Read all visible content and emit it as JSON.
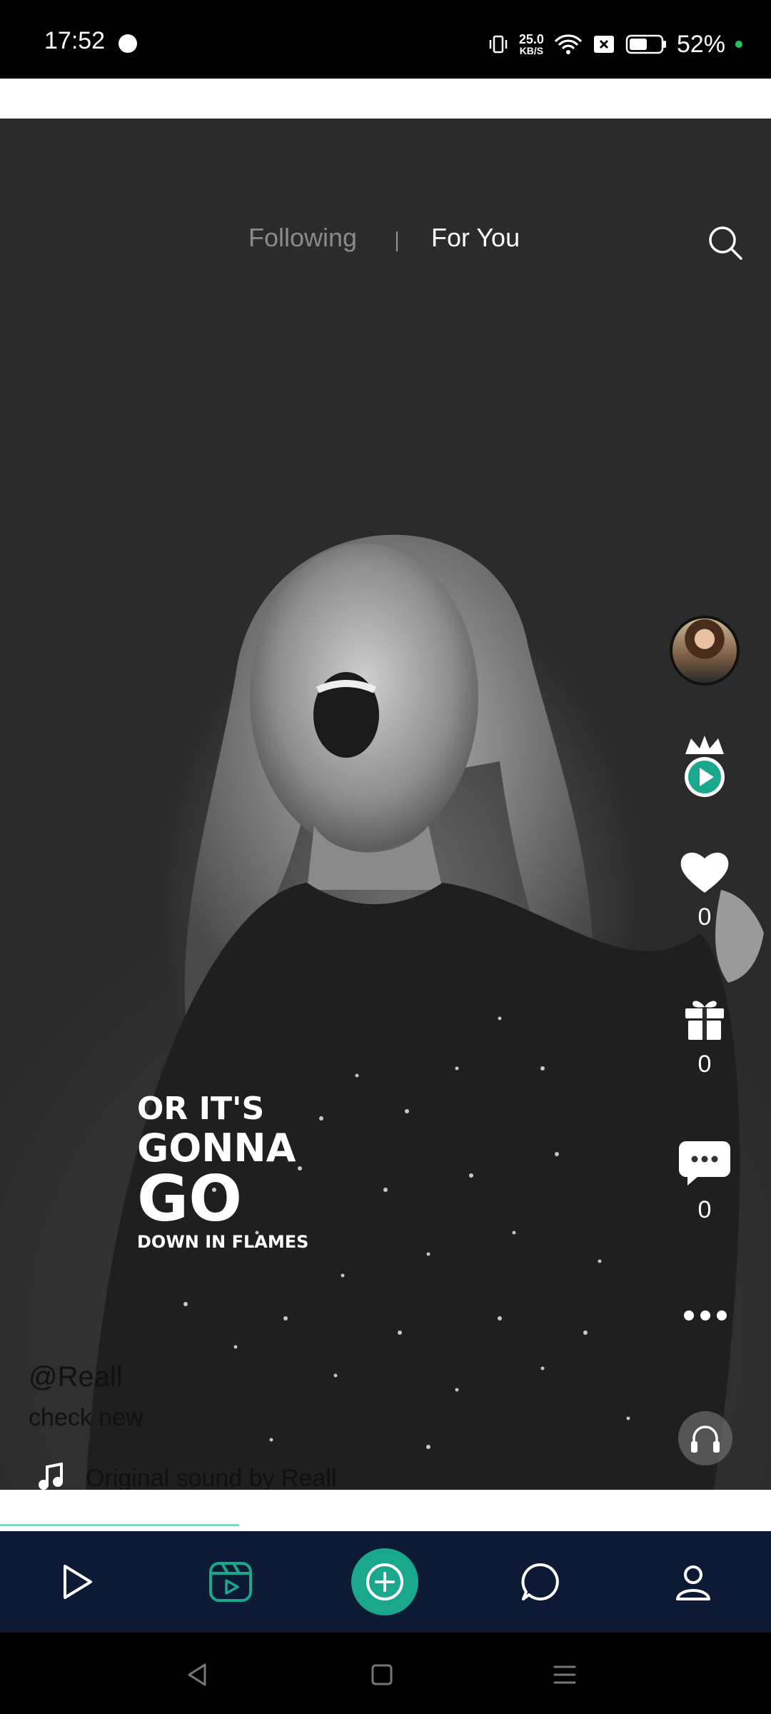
{
  "status_bar": {
    "time": "17:52",
    "net_speed_value": "25.0",
    "net_speed_unit": "KB/S",
    "battery": "52%"
  },
  "feed_tabs": {
    "following": "Following",
    "for_you": "For You"
  },
  "overlay_text": {
    "line1": "OR IT'S",
    "line2": "GONNA",
    "line3": "GO",
    "line4": "DOWN IN FLAMES"
  },
  "actions": {
    "likes": "0",
    "gifts": "0",
    "comments": "0"
  },
  "post": {
    "username": "@Reall",
    "caption": "check new",
    "sound": "Original sound by Reall"
  },
  "colors": {
    "accent": "#1aa88c",
    "nav_bg": "#0d1a36"
  },
  "icons": {
    "nav": [
      "play-icon",
      "reels-icon",
      "add-icon",
      "chat-icon",
      "profile-icon"
    ],
    "system": [
      "back-icon",
      "home-icon",
      "menu-icon"
    ]
  },
  "playback_progress": 0.31
}
